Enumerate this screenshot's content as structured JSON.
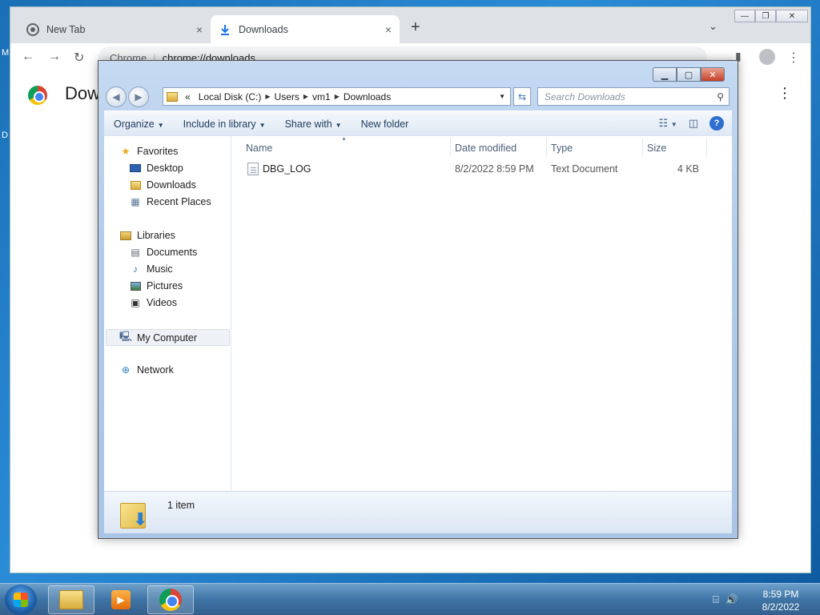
{
  "desktop": {
    "edge_letters": [
      "M",
      "D"
    ]
  },
  "chrome": {
    "tabs": [
      {
        "label": "New Tab",
        "icon": "chrome-icon"
      },
      {
        "label": "Downloads",
        "icon": "download-icon"
      }
    ],
    "new_tab": "+",
    "tab_close": "×",
    "tab_search": "⌄",
    "window_controls": {
      "minimize": "—",
      "maximize": "❐",
      "close": "✕"
    },
    "toolbar": {
      "back": "←",
      "forward": "→",
      "reload": "↻",
      "omnibox_site": "Chrome",
      "omnibox_url": "chrome://downloads"
    },
    "page_title": "Downloads",
    "menu": "⋮"
  },
  "explorer": {
    "window_controls": {
      "minimize": "▁",
      "maximize": "▢",
      "close": "✕"
    },
    "back_glyph": "◀",
    "forward_glyph": "▶",
    "breadcrumb": {
      "lead": "«",
      "items": [
        "Local Disk (C:)",
        "Users",
        "vm1",
        "Downloads"
      ]
    },
    "search_placeholder": "Search Downloads",
    "commands": [
      {
        "label": "Organize",
        "has_dropdown": true
      },
      {
        "label": "Include in library",
        "has_dropdown": true
      },
      {
        "label": "Share with",
        "has_dropdown": true
      },
      {
        "label": "New folder",
        "has_dropdown": false
      }
    ],
    "nav": {
      "favorites": "Favorites",
      "favorites_items": [
        "Desktop",
        "Downloads",
        "Recent Places"
      ],
      "libraries": "Libraries",
      "libraries_items": [
        "Documents",
        "Music",
        "Pictures",
        "Videos"
      ],
      "computer": "My Computer",
      "network": "Network"
    },
    "columns": [
      "Name",
      "Date modified",
      "Type",
      "Size"
    ],
    "files": [
      {
        "name": "DBG_LOG",
        "date_modified": "8/2/2022 8:59 PM",
        "type": "Text Document",
        "size": "4 KB"
      }
    ],
    "item_count": "1 item"
  },
  "taskbar": {
    "time": "8:59 PM",
    "date": "8/2/2022"
  },
  "colors": {
    "desktop": "#1a6fb5",
    "chrome_tabbar": "#dee1e6",
    "explorer_frame": "#b1cbea",
    "taskbar": "#3e74a6"
  }
}
